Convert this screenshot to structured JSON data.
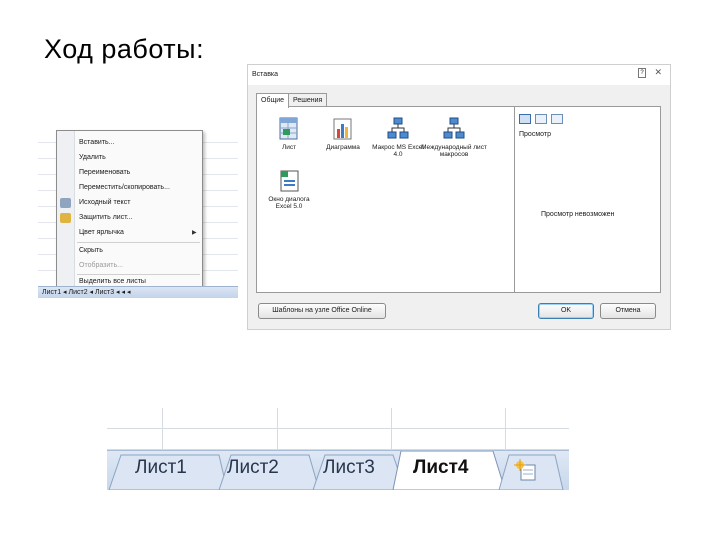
{
  "slide": {
    "title": "Ход работы:"
  },
  "context_menu": {
    "items": [
      {
        "label": "Вставить...",
        "disabled": false
      },
      {
        "label": "Удалить",
        "disabled": false
      },
      {
        "label": "Переименовать",
        "disabled": false
      },
      {
        "label": "Переместить/скопировать...",
        "disabled": false
      },
      {
        "label": "Исходный текст",
        "disabled": false
      },
      {
        "label": "Защитить лист...",
        "disabled": false
      },
      {
        "label": "Цвет ярлычка",
        "disabled": false,
        "submenu": true
      },
      {
        "label": "Скрыть",
        "disabled": false
      },
      {
        "label": "Отобразить...",
        "disabled": true
      },
      {
        "label": "Выделить все листы",
        "disabled": false
      }
    ],
    "sheet_bar": "Лист1 ◂ Лист2 ◂ Лист3 ◂ ◂ ◂"
  },
  "insert_dialog": {
    "title": "Вставка",
    "help_glyph": "?",
    "close_glyph": "✕",
    "tabs": [
      {
        "label": "Общие",
        "active": true
      },
      {
        "label": "Решения",
        "active": false
      }
    ],
    "items": [
      {
        "label": "Лист",
        "icon": "worksheet-icon"
      },
      {
        "label": "Диаграмма",
        "icon": "chart-icon"
      },
      {
        "label": "Макрос MS Excel 4.0",
        "icon": "macro-icon"
      },
      {
        "label": "Международный лист макросов",
        "icon": "intl-macro-icon"
      },
      {
        "label": "Окно диалога Excel 5.0",
        "icon": "dialog-sheet-icon"
      }
    ],
    "preview_label": "Просмотр",
    "preview_empty": "Просмотр невозможен",
    "templates_button": "Шаблоны на узле Office Online",
    "ok_button": "OK",
    "cancel_button": "Отмена"
  },
  "sheet_tabs": {
    "tabs": [
      {
        "label": "Лист1",
        "active": false
      },
      {
        "label": "Лист2",
        "active": false
      },
      {
        "label": "Лист3",
        "active": false
      },
      {
        "label": "Лист4",
        "active": true
      }
    ],
    "insert_icon": "insert-sheet-icon"
  },
  "colors": {
    "tab_bar": "#c8d7ec",
    "menu_border": "#8c8c8c",
    "dialog_bg": "#f0f0f0",
    "accent": "#3c7fb1"
  }
}
